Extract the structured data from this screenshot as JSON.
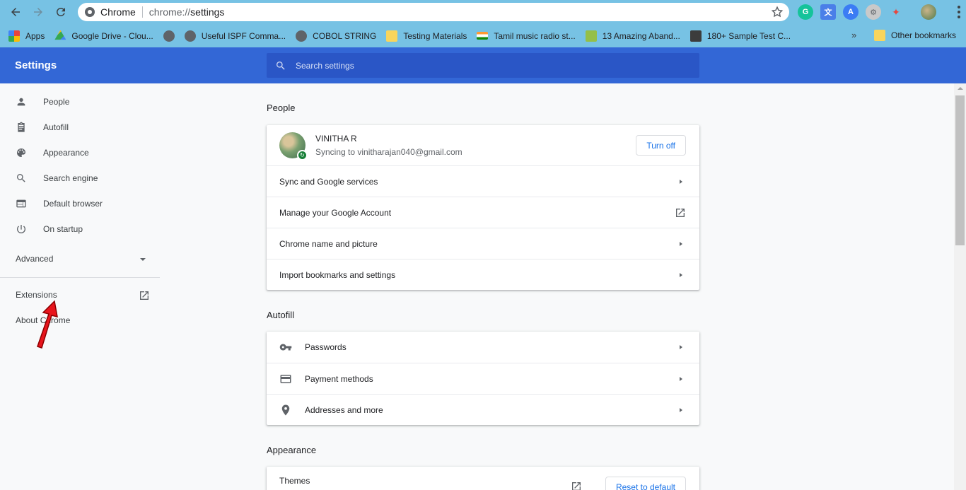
{
  "browser": {
    "site_name": "Chrome",
    "url_scheme": "chrome://",
    "url_path": "settings",
    "icons": [
      "back-icon",
      "forward-icon",
      "reload-icon",
      "star-icon"
    ]
  },
  "bookmarks": {
    "items": [
      {
        "label": "Apps",
        "icon": "apps-icon",
        "color": "#e8453c"
      },
      {
        "label": "Google Drive - Clou...",
        "icon": "drive-icon",
        "color": "#fbbc04"
      },
      {
        "label": "",
        "icon": "globe-icon",
        "color": "#5f6368"
      },
      {
        "label": "Useful ISPF Comma...",
        "icon": "globe-icon",
        "color": "#5f6368"
      },
      {
        "label": "COBOL STRING",
        "icon": "globe-icon",
        "color": "#5f6368"
      },
      {
        "label": "Testing Materials",
        "icon": "folder-icon",
        "color": "#f9d55c"
      },
      {
        "label": "Tamil music radio st...",
        "icon": "flag-icon",
        "color": "#ff9933"
      },
      {
        "label": "13 Amazing Aband...",
        "icon": "shopify-icon",
        "color": "#95bf47"
      },
      {
        "label": "180+ Sample Test C...",
        "icon": "site-icon",
        "color": "#3c3c3c"
      }
    ],
    "more": "»",
    "other": "Other bookmarks"
  },
  "settings": {
    "title": "Settings",
    "search_placeholder": "Search settings"
  },
  "sidebar": {
    "items": [
      {
        "label": "People",
        "icon": "person-icon"
      },
      {
        "label": "Autofill",
        "icon": "clipboard-icon"
      },
      {
        "label": "Appearance",
        "icon": "palette-icon"
      },
      {
        "label": "Search engine",
        "icon": "search-icon"
      },
      {
        "label": "Default browser",
        "icon": "browser-icon"
      },
      {
        "label": "On startup",
        "icon": "power-icon"
      }
    ],
    "advanced": "Advanced",
    "extensions": "Extensions",
    "about": "About Chrome"
  },
  "people": {
    "section": "People",
    "name": "VINITHA R",
    "email": "Syncing to vinitharajan040@gmail.com",
    "turn_off": "Turn off",
    "rows": [
      "Sync and Google services",
      "Manage your Google Account",
      "Chrome name and picture",
      "Import bookmarks and settings"
    ]
  },
  "autofill": {
    "section": "Autofill",
    "rows": [
      {
        "label": "Passwords",
        "icon": "key-icon"
      },
      {
        "label": "Payment methods",
        "icon": "credit-card-icon"
      },
      {
        "label": "Addresses and more",
        "icon": "location-pin-icon"
      }
    ]
  },
  "appearance": {
    "section": "Appearance",
    "themes": "Themes",
    "reset": "Reset to default"
  },
  "colors": {
    "header_blue": "#3367d6",
    "browser_frame": "#77c2e4",
    "link_blue": "#1a73e8"
  }
}
